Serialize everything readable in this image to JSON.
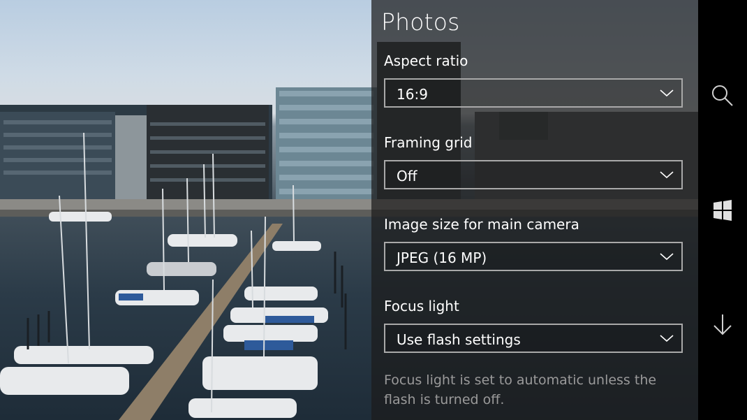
{
  "pane": {
    "title": "Photos",
    "settings": [
      {
        "label": "Aspect ratio",
        "value": "16:9"
      },
      {
        "label": "Framing grid",
        "value": "Off"
      },
      {
        "label": "Image size for main camera",
        "value": "JPEG (16 MP)"
      },
      {
        "label": "Focus light",
        "value": "Use flash settings"
      }
    ],
    "hint": "Focus light is set to automatic unless the flash is turned off."
  },
  "appbar": {
    "icons": [
      "search-icon",
      "windows-logo-icon",
      "arrow-down-icon"
    ]
  },
  "photo": {
    "description_icon": "harbor-photo"
  }
}
